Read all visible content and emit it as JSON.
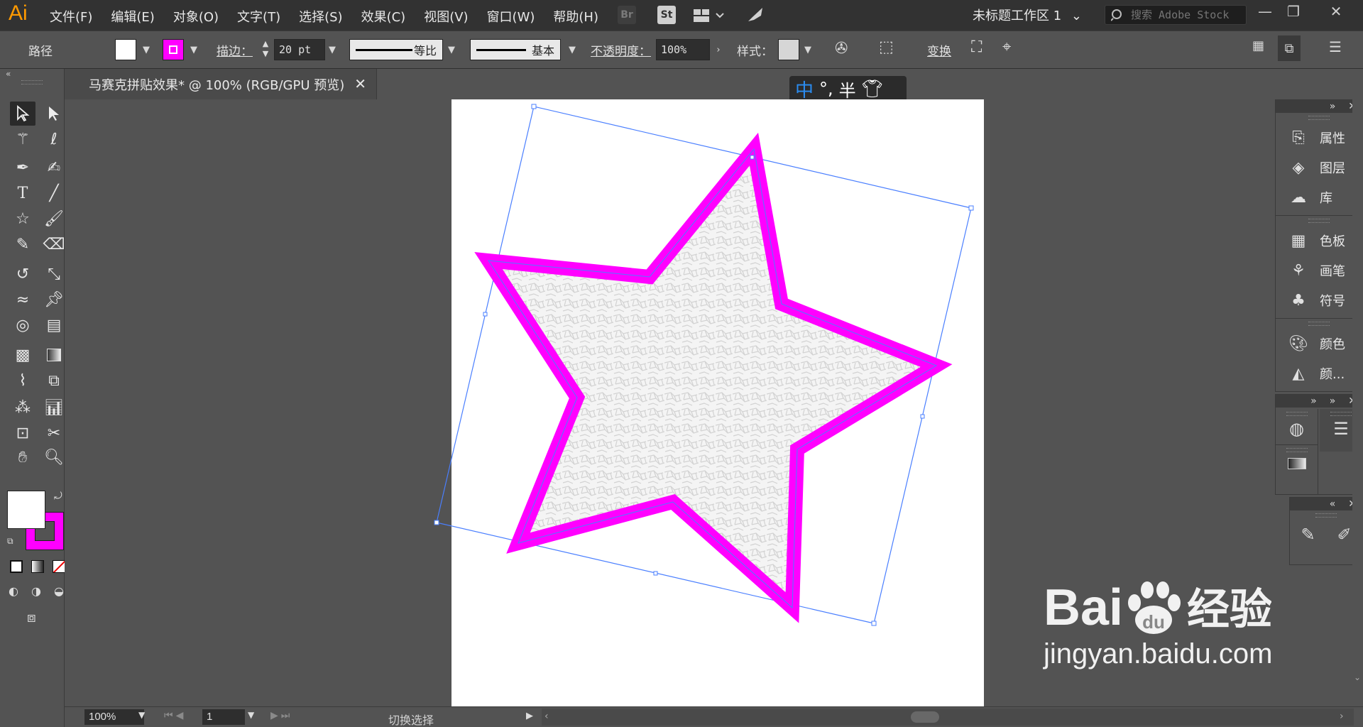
{
  "menubar": {
    "logo": "Ai",
    "items": [
      "文件(F)",
      "编辑(E)",
      "对象(O)",
      "文字(T)",
      "选择(S)",
      "效果(C)",
      "视图(V)",
      "窗口(W)",
      "帮助(H)"
    ],
    "bridge_label": "Br",
    "stock_label": "St",
    "workspace": "未标题工作区 1",
    "search_placeholder": "搜索 Adobe Stock"
  },
  "control": {
    "object_type": "路径",
    "fill_color": "#ffffff",
    "stroke_color": "#ff00ff",
    "stroke_label": "描边：",
    "stroke_value": "20 pt",
    "profile_label": "等比",
    "brush_label": "基本",
    "opacity_label": "不透明度：",
    "opacity_value": "100%",
    "style_label": "样式：",
    "transform_label": "变换"
  },
  "document": {
    "tab_title": "马赛克拼贴效果* @ 100% (RGB/GPU 预览)"
  },
  "ime": {
    "mode": "中",
    "punct": "°,",
    "width": "半"
  },
  "panels": {
    "group1": [
      "属性",
      "图层",
      "库"
    ],
    "group2": [
      "色板",
      "画笔",
      "符号"
    ],
    "group3": [
      "颜色",
      "颜..."
    ]
  },
  "status": {
    "zoom": "100%",
    "page": "1",
    "text": "切换选择"
  },
  "watermark": {
    "brand": "Bai",
    "brand2": "du",
    "cn": "经验",
    "url": "jingyan.baidu.com"
  },
  "colors": {
    "accent_magenta": "#ff00ff",
    "selection_blue": "#4a7fff",
    "logo_orange": "#ff9a00"
  }
}
